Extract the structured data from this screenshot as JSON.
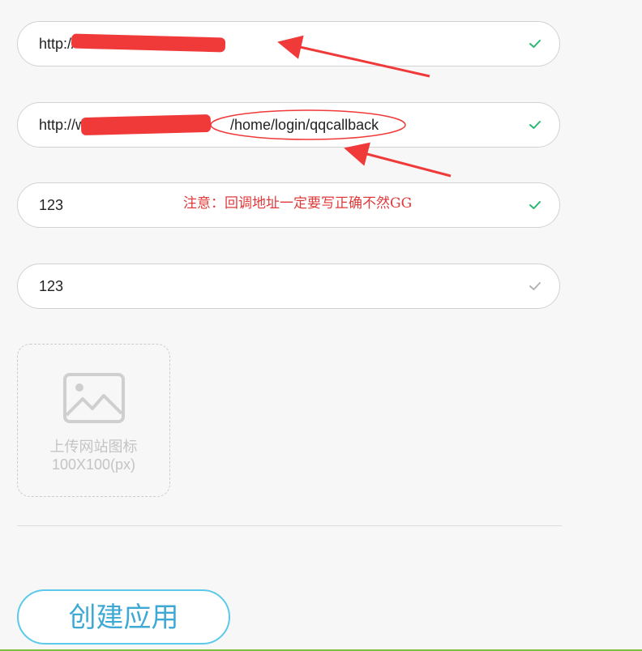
{
  "form": {
    "fields": [
      {
        "value": "http://",
        "status_icon": "check-icon",
        "status_color": "#2bb673"
      },
      {
        "value_prefix": "http://w",
        "value_suffix": "/home/login/qqcallback",
        "status_icon": "check-icon",
        "status_color": "#2bb673"
      },
      {
        "value": "123",
        "status_icon": "check-icon",
        "status_color": "#2bb673"
      },
      {
        "value": "123",
        "status_icon": "check-icon",
        "status_color": "#b3b3b3"
      }
    ],
    "upload": {
      "icon": "image-icon",
      "title": "上传网站图标",
      "size": "100X100(px)"
    },
    "create_button_label": "创建应用"
  },
  "annotation": {
    "note": "注意：回调地址一定要写正确不然GG",
    "color": "#f03a3a"
  }
}
